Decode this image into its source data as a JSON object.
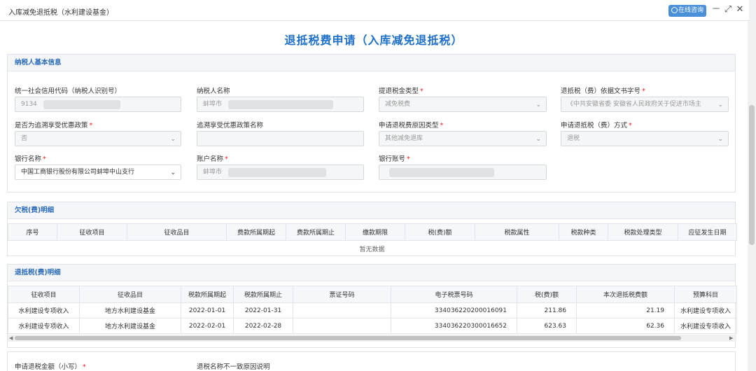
{
  "window": {
    "title": "入库减免退抵税（水利建设基金）",
    "online_consult": "在线咨询",
    "minimize": "－",
    "maximize": "⤢",
    "close": "✕"
  },
  "page_title": "退抵税费申请（入库减免退抵税）",
  "taxpayer": {
    "section_title": "纳税人基本信息",
    "credit_code_label": "统一社会信用代码（纳税人识别号）",
    "credit_code_value": "9134",
    "name_label": "纳税人名称",
    "name_value": "蚌埠市",
    "refund_type_label": "提退税金类型",
    "refund_type_value": "减免税费",
    "basis_doc_label": "退抵税（费）依据文书字号",
    "basis_doc_value": "《中共安徽省委 安徽省人民政府关于促进市场主",
    "backdate_label": "是否为追溯享受优惠政策",
    "backdate_value": "否",
    "policy_name_label": "追溯享受优惠政策名称",
    "policy_name_value": "",
    "reason_type_label": "申请退税费原因类型",
    "reason_type_value": "其他减免退库",
    "method_label": "申请退抵税（费）方式",
    "method_value": "退税",
    "bank_label": "银行名称",
    "bank_value": "中国工商银行股份有限公司蚌埠中山支行",
    "account_name_label": "账户名称",
    "account_name_value": "蚌埠市",
    "account_no_label": "银行账号",
    "account_no_value": ""
  },
  "owed": {
    "section_title": "欠税(费)明细",
    "columns": [
      "序号",
      "征收项目",
      "征收品目",
      "费款所属期起",
      "费款所属期止",
      "缴款期限",
      "税(费)额",
      "税款属性",
      "税款种类",
      "税款处理类型",
      "应征发生日期"
    ],
    "empty_text": "暂无数据"
  },
  "refund": {
    "section_title": "退抵税(费)明细",
    "columns": [
      "征收项目",
      "征收品目",
      "税款所属期起",
      "税款所属期止",
      "票证号码",
      "电子税票号码",
      "税(费)额",
      "本次退抵税费额",
      "预算科目"
    ],
    "rows": [
      [
        "水利建设专项收入",
        "地方水利建设基金",
        "2022-01-01",
        "2022-01-31",
        "",
        "334036220200016091",
        "211.86",
        "21.19",
        "水利建设专项收入"
      ],
      [
        "水利建设专项收入",
        "地方水利建设基金",
        "2022-02-01",
        "2022-02-28",
        "",
        "334036220300016652",
        "623.63",
        "62.36",
        "水利建设专项收入"
      ]
    ]
  },
  "bottom": {
    "amount_label": "申请退税金额（小写）",
    "mismatch_label": "退税名称不一致原因说明"
  }
}
